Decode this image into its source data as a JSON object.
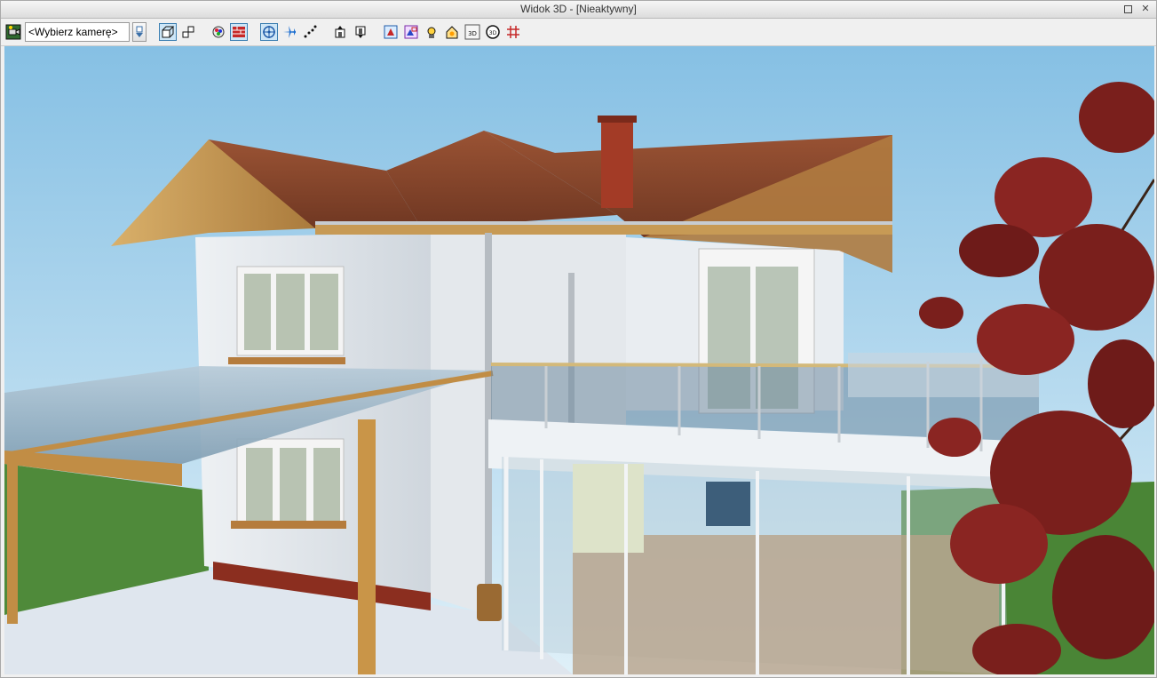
{
  "window": {
    "title": "Widok 3D - [Nieaktywny]"
  },
  "toolbar": {
    "camera_select": {
      "value": "<Wybierz kamerę>"
    },
    "tools": [
      {
        "icon": "camera-scene-icon",
        "active": false
      },
      {
        "icon": "dropdown-arrow-icon",
        "active": false
      },
      {
        "icon": "perspective-view-icon",
        "active": true
      },
      {
        "icon": "axonometric-view-icon",
        "active": false
      },
      {
        "icon": "render-icon",
        "active": false
      },
      {
        "icon": "wall-section-icon",
        "active": true
      },
      {
        "icon": "orbit-icon",
        "active": true
      },
      {
        "icon": "fly-mode-icon",
        "active": false
      },
      {
        "icon": "walk-path-icon",
        "active": false
      },
      {
        "icon": "level-up-icon",
        "active": false
      },
      {
        "icon": "level-down-icon",
        "active": false
      },
      {
        "icon": "zoom-fit-icon",
        "active": false
      },
      {
        "icon": "zoom-window-icon",
        "active": false
      },
      {
        "icon": "sun-settings-icon",
        "active": false
      },
      {
        "icon": "house-light-icon",
        "active": false
      },
      {
        "icon": "view-3d-icon",
        "active": false
      },
      {
        "icon": "rotate-3d-icon",
        "active": false
      },
      {
        "icon": "grid-settings-icon",
        "active": false
      }
    ]
  },
  "colors": {
    "sky_top": "#8cc4e6",
    "sky_bottom": "#d6ecf6",
    "roof": "#8a4a2e",
    "wall": "#dfe4e9",
    "wood": "#b98a4a",
    "grass": "#4f8a3a",
    "tree_leaves": "#7a1f1c",
    "glass": "#9cb6c8"
  }
}
